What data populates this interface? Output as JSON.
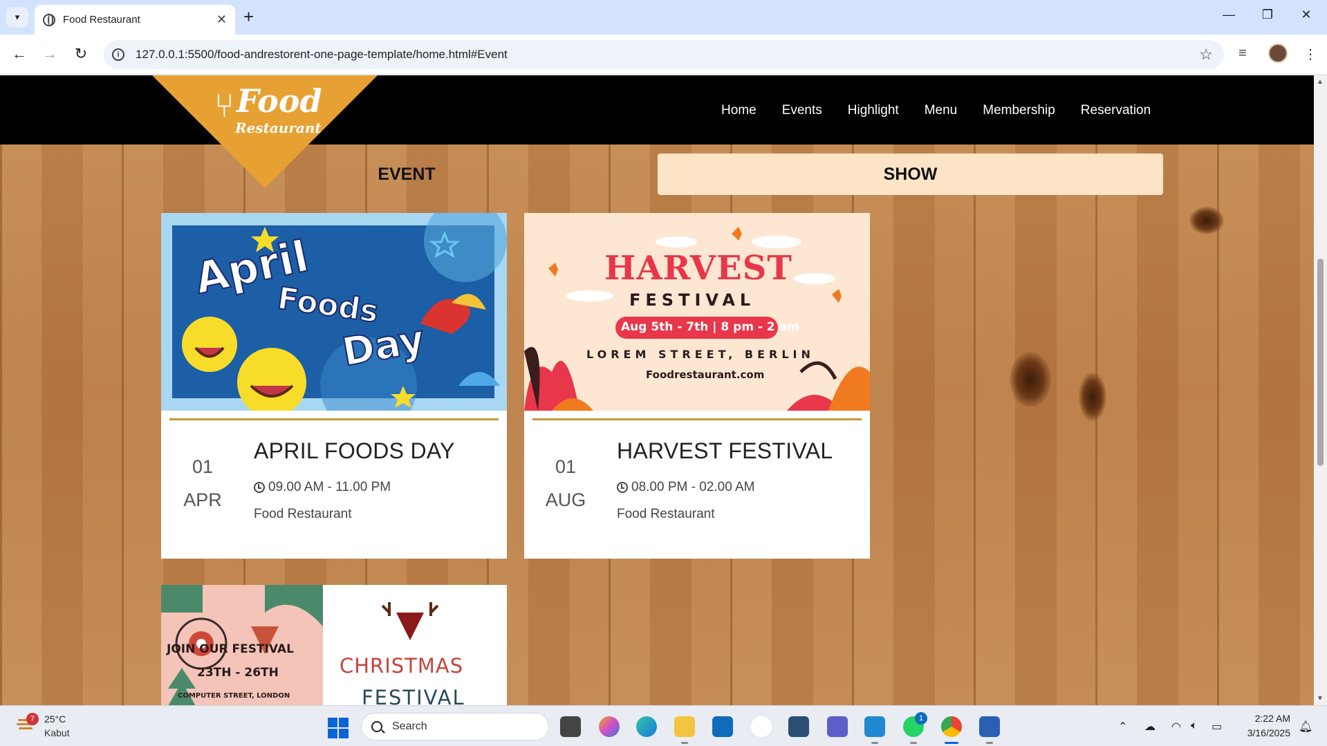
{
  "browser": {
    "tab_title": "Food Restaurant",
    "url": "127.0.0.1:5500/food-andrestorent-one-page-template/home.html#Event",
    "new_tab_label": "+",
    "close_tab_label": "✕"
  },
  "site": {
    "logo_main": "Food",
    "logo_sub": "Restaurant",
    "nav": [
      "Home",
      "Events",
      "Highlight",
      "Menu",
      "Membership",
      "Reservation"
    ],
    "tabs": {
      "event": "EVENT",
      "show": "SHOW"
    }
  },
  "events": [
    {
      "title": "APRIL FOODS DAY",
      "day": "01",
      "month": "APR",
      "time": "09.00 AM - 11.00 PM",
      "venue": "Food Restaurant",
      "poster": {
        "line1": "April",
        "line2": "Foods",
        "line3": "Day"
      }
    },
    {
      "title": "HARVEST FESTIVAL",
      "day": "01",
      "month": "AUG",
      "time": "08.00 PM - 02.00 AM",
      "venue": "Food Restaurant",
      "poster": {
        "heading": "HARVEST",
        "sub": "FESTIVAL",
        "dates": "Aug 5th - 7th | 8 pm - 2 am",
        "address": "LOREM STREET, BERLIN",
        "site": "Foodrestaurant.com"
      }
    },
    {
      "poster": {
        "left_line1": "JOIN OUR FESTIVAL",
        "left_line2": "23TH - 26TH",
        "left_line3": "COMPUTER STREET, LONDON",
        "right_line1": "CHRISTMAS",
        "right_line2": "FESTIVAL"
      }
    }
  ],
  "taskbar": {
    "weather_temp": "25°C",
    "weather_desc": "Kabut",
    "weather_badge": "7",
    "search_placeholder": "Search",
    "whatsapp_badge": "1",
    "time": "2:22 AM",
    "date": "3/16/2025"
  },
  "colors": {
    "accent_orange": "#e7a132",
    "show_tab_bg": "#fde4c6",
    "card_rule": "#c9953c"
  }
}
